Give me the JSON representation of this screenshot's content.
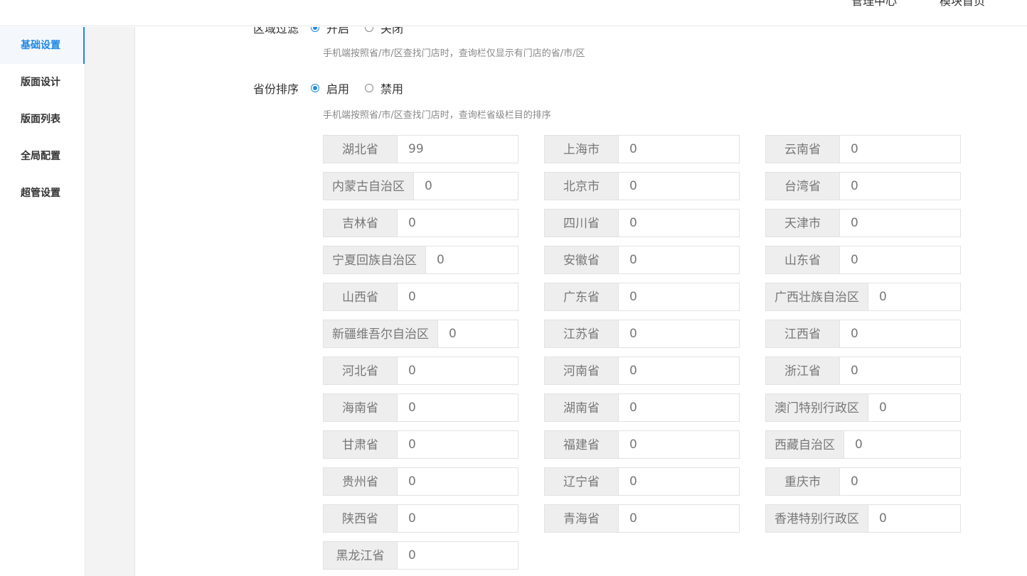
{
  "header": {
    "nav": [
      "管理中心",
      "模块首页"
    ]
  },
  "sidebar": {
    "items": [
      {
        "label": "基础设置",
        "active": true
      },
      {
        "label": "版面设计",
        "active": false
      },
      {
        "label": "版面列表",
        "active": false
      },
      {
        "label": "全局配置",
        "active": false
      },
      {
        "label": "超管设置",
        "active": false
      }
    ]
  },
  "area_filter": {
    "label": "区域过滤",
    "options": [
      "开启",
      "关闭"
    ],
    "selected": "开启",
    "hint": "手机端按照省/市/区查找门店时，查询栏仅显示有门店的省/市/区"
  },
  "province_sort": {
    "label": "省份排序",
    "options": [
      "启用",
      "禁用"
    ],
    "selected": "启用",
    "hint": "手机端按照省/市/区查找门店时，查询栏省级栏目的排序"
  },
  "provinces": [
    [
      {
        "name": "湖北省",
        "value": "99"
      },
      {
        "name": "上海市",
        "value": "0"
      },
      {
        "name": "云南省",
        "value": "0"
      }
    ],
    [
      {
        "name": "内蒙古自治区",
        "value": "0"
      },
      {
        "name": "北京市",
        "value": "0"
      },
      {
        "name": "台湾省",
        "value": "0"
      }
    ],
    [
      {
        "name": "吉林省",
        "value": "0"
      },
      {
        "name": "四川省",
        "value": "0"
      },
      {
        "name": "天津市",
        "value": "0"
      }
    ],
    [
      {
        "name": "宁夏回族自治区",
        "value": "0"
      },
      {
        "name": "安徽省",
        "value": "0"
      },
      {
        "name": "山东省",
        "value": "0"
      }
    ],
    [
      {
        "name": "山西省",
        "value": "0"
      },
      {
        "name": "广东省",
        "value": "0"
      },
      {
        "name": "广西壮族自治区",
        "value": "0"
      }
    ],
    [
      {
        "name": "新疆维吾尔自治区",
        "value": "0"
      },
      {
        "name": "江苏省",
        "value": "0"
      },
      {
        "name": "江西省",
        "value": "0"
      }
    ],
    [
      {
        "name": "河北省",
        "value": "0"
      },
      {
        "name": "河南省",
        "value": "0"
      },
      {
        "name": "浙江省",
        "value": "0"
      }
    ],
    [
      {
        "name": "海南省",
        "value": "0"
      },
      {
        "name": "湖南省",
        "value": "0"
      },
      {
        "name": "澳门特别行政区",
        "value": "0"
      }
    ],
    [
      {
        "name": "甘肃省",
        "value": "0"
      },
      {
        "name": "福建省",
        "value": "0"
      },
      {
        "name": "西藏自治区",
        "value": "0"
      }
    ],
    [
      {
        "name": "贵州省",
        "value": "0"
      },
      {
        "name": "辽宁省",
        "value": "0"
      },
      {
        "name": "重庆市",
        "value": "0"
      }
    ],
    [
      {
        "name": "陕西省",
        "value": "0"
      },
      {
        "name": "青海省",
        "value": "0"
      },
      {
        "name": "香港特别行政区",
        "value": "0"
      }
    ],
    [
      {
        "name": "黑龙江省",
        "value": "0"
      }
    ]
  ],
  "colors": {
    "accent": "#1e88e5",
    "addon_bg": "#eeeeee",
    "border": "#e2e2e2"
  }
}
